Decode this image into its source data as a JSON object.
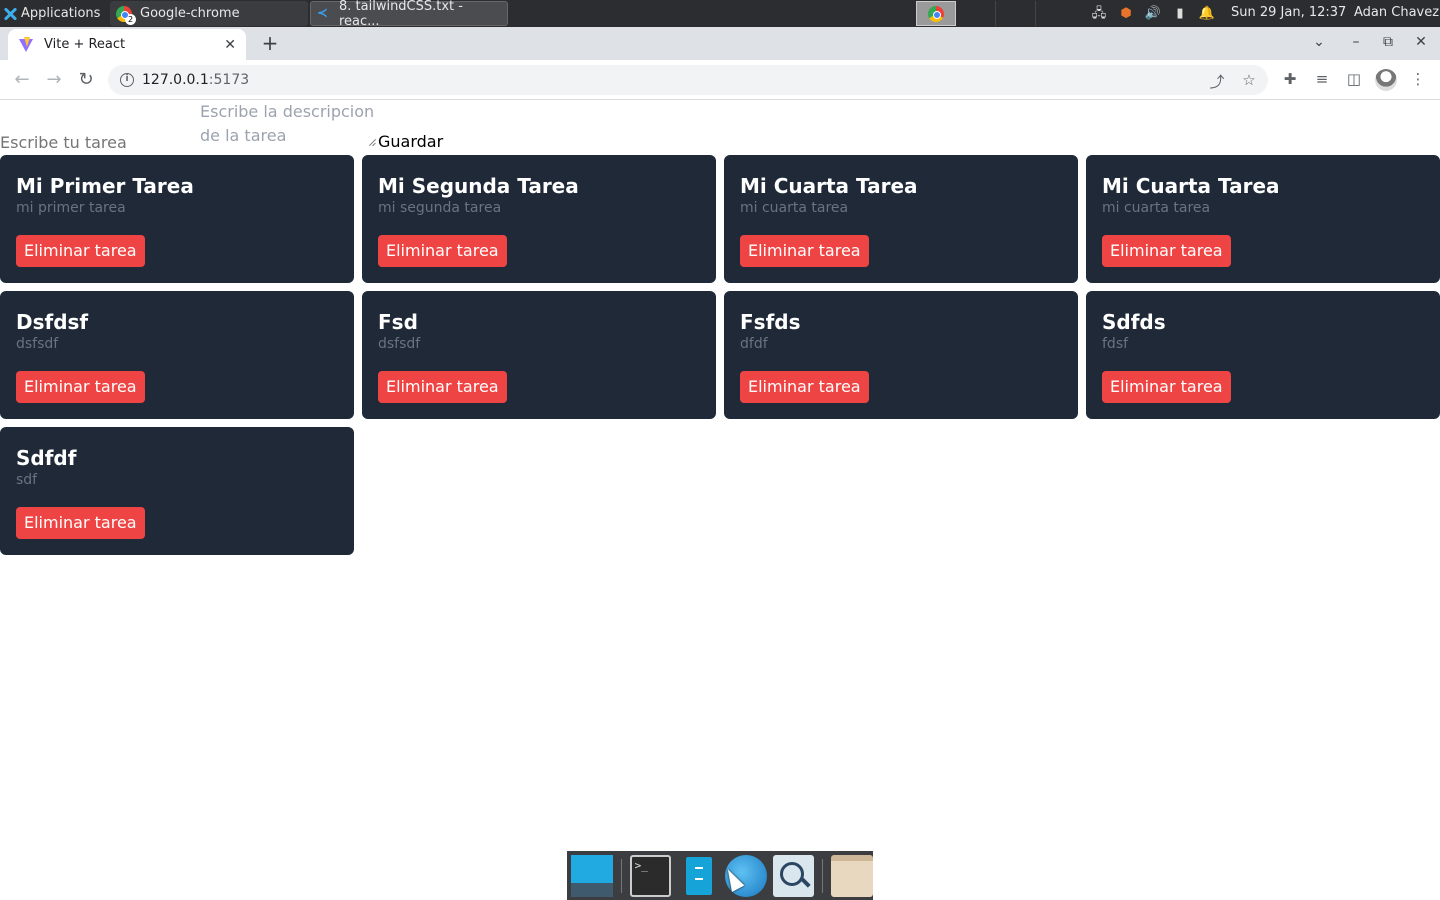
{
  "system_panel": {
    "applications_label": "Applications",
    "tasks": [
      {
        "label": "Google-chrome",
        "badge": "2"
      },
      {
        "label": "8. tailwindCSS.txt - reac..."
      }
    ],
    "clock": "Sun 29 Jan, 12:37",
    "user": "Adan Chavez"
  },
  "browser": {
    "tab_title": "Vite + React",
    "url_host": "127.0.0.1",
    "url_port": ":5173"
  },
  "app": {
    "form": {
      "title_placeholder": "Escribe tu tarea",
      "description_placeholder": "Escribe la descripcion de la tarea",
      "save_label": "Guardar"
    },
    "delete_label": "Eliminar tarea",
    "tasks": [
      {
        "title": "Mi Primer Tarea",
        "description": "mi primer tarea"
      },
      {
        "title": "Mi Segunda Tarea",
        "description": "mi segunda tarea"
      },
      {
        "title": "Mi Cuarta Tarea",
        "description": "mi cuarta tarea"
      },
      {
        "title": "Mi Cuarta Tarea",
        "description": "mi cuarta tarea"
      },
      {
        "title": "Dsfdsf",
        "description": "dsfsdf"
      },
      {
        "title": "Fsd",
        "description": "dsfsdf"
      },
      {
        "title": "Fsfds",
        "description": "dfdf"
      },
      {
        "title": "Sdfds",
        "description": "fdsf"
      },
      {
        "title": "Sdfdf",
        "description": "sdf"
      }
    ]
  },
  "colors": {
    "card_bg": "#1f2937",
    "delete_button": "#ef4444",
    "placeholder": "#9ca3af",
    "card_description": "#6b7280"
  }
}
